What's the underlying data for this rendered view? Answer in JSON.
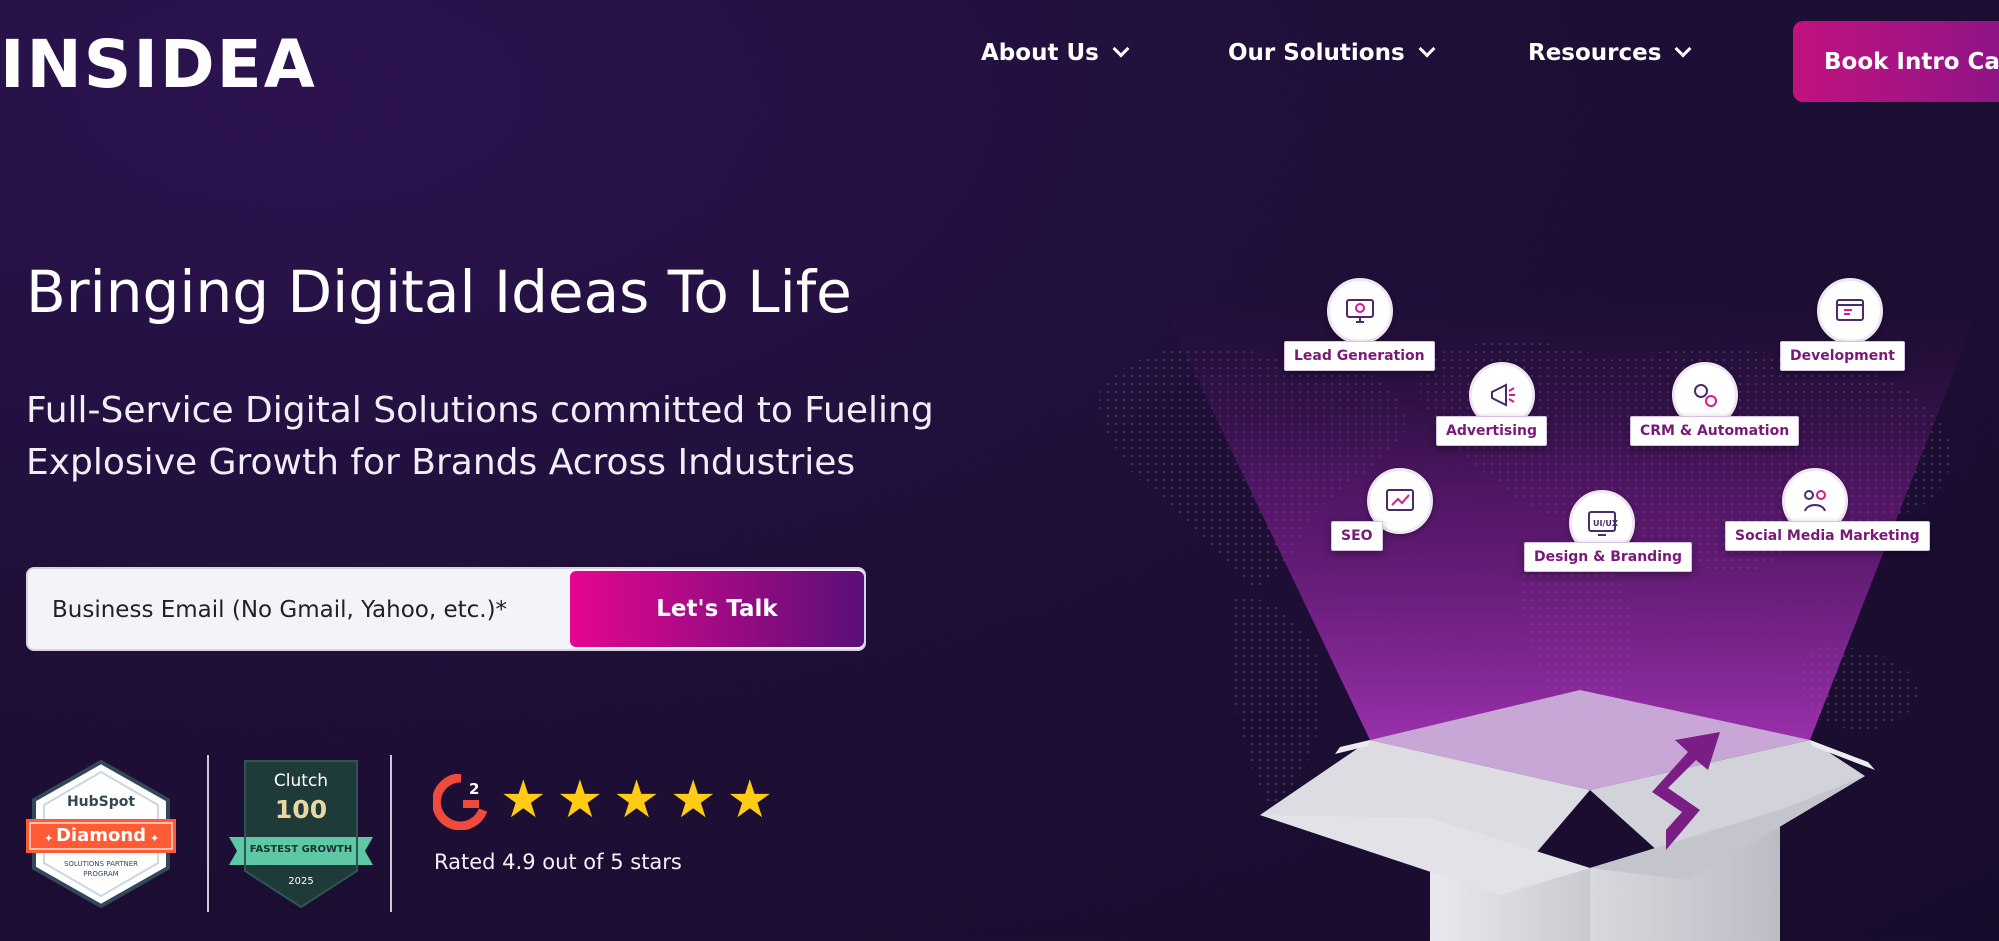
{
  "header": {
    "logo_text": "INSIDEA",
    "nav": [
      {
        "label": "About Us"
      },
      {
        "label": "Our Solutions"
      },
      {
        "label": "Resources"
      }
    ],
    "cta_label": "Book Intro Call"
  },
  "hero": {
    "title": "Bringing Digital Ideas To Life",
    "subtitle": "Full-Service Digital Solutions committed to Fueling Explosive Growth for Brands Across Industries",
    "email_placeholder": "Business Email (No Gmail, Yahoo, etc.)*",
    "submit_label": "Let's Talk"
  },
  "badges": {
    "hubspot": {
      "brand": "HubSpot",
      "tier": "Diamond",
      "line1": "SOLUTIONS PARTNER",
      "line2": "PROGRAM"
    },
    "clutch": {
      "brand": "Clutch",
      "number": "100",
      "ribbon": "FASTEST GROWTH",
      "year": "2025"
    },
    "g2": {
      "logo_text": "G2",
      "stars": 5,
      "rating_text": "Rated 4.9 out of 5 stars",
      "star_color": "#ffcb14"
    }
  },
  "illustration": {
    "services": [
      {
        "label": "Lead Generation",
        "icon": "monitor-gear-icon"
      },
      {
        "label": "Development",
        "icon": "browser-code-icon"
      },
      {
        "label": "Advertising",
        "icon": "megaphone-icon"
      },
      {
        "label": "CRM & Automation",
        "icon": "gears-icon"
      },
      {
        "label": "SEO",
        "icon": "seo-chart-icon"
      },
      {
        "label": "Design & Branding",
        "icon": "ui-ux-icon"
      },
      {
        "label": "Social Media Marketing",
        "icon": "social-network-icon"
      }
    ],
    "ui_ux_label": "UI/UX"
  },
  "colors": {
    "background": "#1f0f38",
    "accent_pink": "#e6068f",
    "accent_purple": "#5a0f78"
  }
}
